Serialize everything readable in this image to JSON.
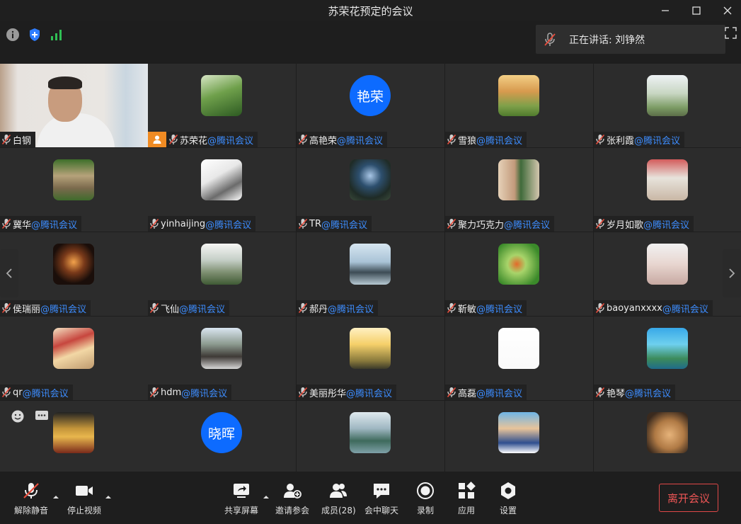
{
  "window": {
    "title": "苏荣花预定的会议"
  },
  "topbar": {
    "speaking_label": "正在讲话: 刘铮然"
  },
  "org_suffix": "@腾讯会议",
  "participants": [
    {
      "name": "白钢",
      "suffix": ""
    },
    {
      "name": "苏荣花",
      "suffix": "@腾讯会议"
    },
    {
      "name": "高艳荣",
      "suffix": "@腾讯会议",
      "avatar_text": "艳荣"
    },
    {
      "name": "雪狼",
      "suffix": "@腾讯会议"
    },
    {
      "name": "张利霞",
      "suffix": "@腾讯会议"
    },
    {
      "name": "冀华",
      "suffix": "@腾讯会议"
    },
    {
      "name": "yinhaijing",
      "suffix": "@腾讯会议"
    },
    {
      "name": "TR",
      "suffix": "@腾讯会议"
    },
    {
      "name": "聚力巧克力",
      "suffix": "@腾讯会议"
    },
    {
      "name": "岁月如歌",
      "suffix": "@腾讯会议"
    },
    {
      "name": "侯瑞丽",
      "suffix": "@腾讯会议"
    },
    {
      "name": "飞仙",
      "suffix": "@腾讯会议"
    },
    {
      "name": "郝丹",
      "suffix": "@腾讯会议"
    },
    {
      "name": "靳敏",
      "suffix": "@腾讯会议"
    },
    {
      "name": "baoyanxxxx",
      "suffix": "@腾讯会议"
    },
    {
      "name": "qr",
      "suffix": "@腾讯会议"
    },
    {
      "name": "hdm",
      "suffix": "@腾讯会议"
    },
    {
      "name": "美丽彤华",
      "suffix": "@腾讯会议"
    },
    {
      "name": "高磊",
      "suffix": "@腾讯会议"
    },
    {
      "name": "艳琴",
      "suffix": "@腾讯会议"
    },
    {
      "name": "",
      "suffix": ""
    },
    {
      "name": "",
      "suffix": "",
      "avatar_text": "晓晖"
    },
    {
      "name": "",
      "suffix": ""
    },
    {
      "name": "",
      "suffix": ""
    },
    {
      "name": "",
      "suffix": ""
    }
  ],
  "toolbar": {
    "unmute": "解除静音",
    "stop_video": "停止视频",
    "share_screen": "共享屏幕",
    "invite": "邀请参会",
    "members": "成员(28)",
    "chat": "会中聊天",
    "record": "录制",
    "apps": "应用",
    "settings": "设置",
    "leave": "离开会议"
  },
  "colors": {
    "accent_blue": "#0d6bff",
    "name_blue": "#3d8dff",
    "leave_red": "#ef5656",
    "host_orange": "#f08b23"
  }
}
